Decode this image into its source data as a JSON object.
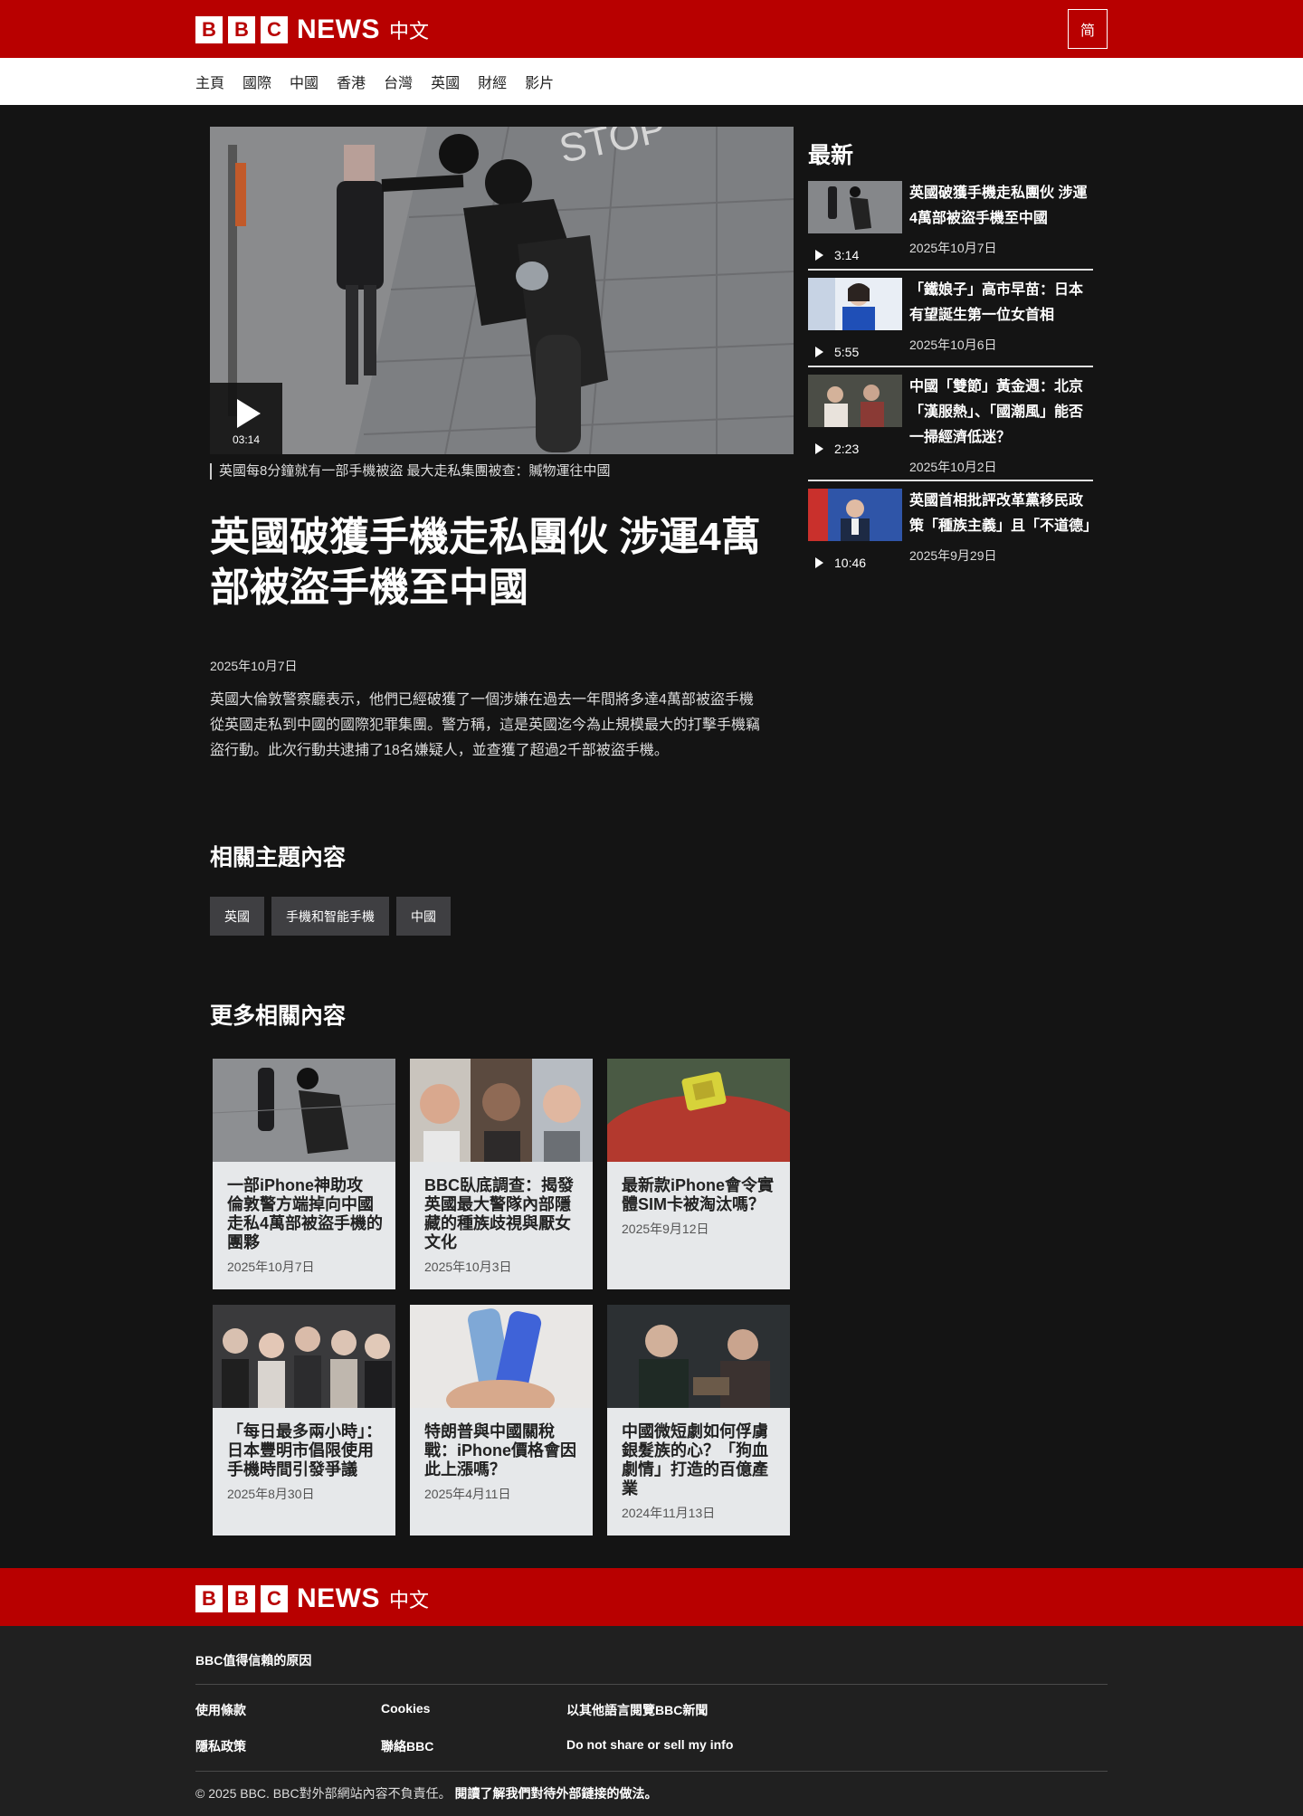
{
  "brand": {
    "box_letters": [
      "B",
      "B",
      "C"
    ],
    "news": "NEWS",
    "zh": "中文",
    "color": "#b80000"
  },
  "header": {
    "lang_toggle": "简"
  },
  "nav": {
    "items": [
      "主頁",
      "國際",
      "中國",
      "香港",
      "台灣",
      "英國",
      "財經",
      "影片"
    ]
  },
  "hero": {
    "duration": "03:14",
    "caption": "英國每8分鐘就有一部手機被盜 最大走私集團被查：贓物運往中國"
  },
  "article": {
    "headline": "英國破獲手機走私團伙 涉運4萬部被盜手機至中國",
    "date": "2025年10月7日",
    "summary": "英國大倫敦警察廳表示，他們已經破獲了一個涉嫌在過去一年間將多達4萬部被盜手機從英國走私到中國的國際犯罪集團。警方稱，這是英國迄今為止規模最大的打擊手機竊盜行動。此次行動共逮捕了18名嫌疑人，並查獲了超過2千部被盜手機。"
  },
  "topics": {
    "title": "相關主題內容",
    "tags": [
      "英國",
      "手機和智能手機",
      "中國"
    ]
  },
  "more": {
    "title": "更多相關內容",
    "cards": [
      {
        "title": "一部iPhone神助攻 倫敦警方端掉向中國走私4萬部被盜手機的團夥",
        "date": "2025年10月7日"
      },
      {
        "title": "BBC臥底調查：揭發英國最大警隊內部隱藏的種族歧視與厭女文化",
        "date": "2025年10月3日"
      },
      {
        "title": "最新款iPhone會令實體SIM卡被淘汰嗎？",
        "date": "2025年9月12日"
      },
      {
        "title": "「每日最多兩小時」：日本豐明市倡限使用手機時間引發爭議",
        "date": "2025年8月30日"
      },
      {
        "title": "特朗普與中國關稅戰：iPhone價格會因此上漲嗎？",
        "date": "2025年4月11日"
      },
      {
        "title": "中國微短劇如何俘虜銀髮族的心？「狗血劇情」打造的百億產業",
        "date": "2024年11月13日"
      }
    ]
  },
  "latest": {
    "title": "最新",
    "items": [
      {
        "title": "英國破獲手機走私團伙 涉運4萬部被盜手機至中國",
        "duration": "3:14",
        "date": "2025年10月7日"
      },
      {
        "title": "「鐵娘子」高市早苗：日本有望誕生第一位女首相",
        "duration": "5:55",
        "date": "2025年10月6日"
      },
      {
        "title": "中國「雙節」黃金週：北京「漢服熱」、「國潮風」能否一掃經濟低迷？",
        "duration": "2:23",
        "date": "2025年10月2日"
      },
      {
        "title": "英國首相批評改革黨移民政策「種族主義」且「不道德」",
        "duration": "10:46",
        "date": "2025年9月29日"
      }
    ]
  },
  "footer": {
    "trust": "BBC值得信賴的原因",
    "links": {
      "terms": "使用條款",
      "cookies": "Cookies",
      "other_langs": "以其他語言閱覽BBC新聞",
      "privacy": "隱私政策",
      "contact": "聯絡BBC",
      "dns": "Do not share or sell my info"
    },
    "copyright": "© 2025 BBC. BBC對外部網站內容不負責任。",
    "external_link": "閱讀了解我們對待外部鏈接的做法。"
  }
}
